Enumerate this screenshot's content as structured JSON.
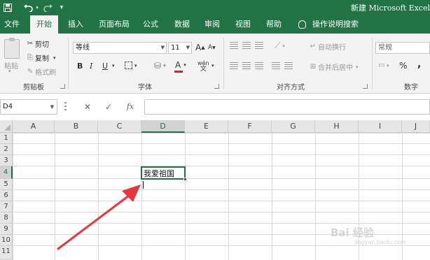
{
  "titlebar": {
    "document_title": "新建 Microsoft Excel",
    "save_icon": "save-icon",
    "undo_icon": "undo-icon",
    "redo_icon": "redo-icon",
    "customize_icon": "customize-quick-access-icon"
  },
  "tabs": [
    {
      "label": "文件"
    },
    {
      "label": "开始"
    },
    {
      "label": "插入"
    },
    {
      "label": "页面布局"
    },
    {
      "label": "公式"
    },
    {
      "label": "数据"
    },
    {
      "label": "审阅"
    },
    {
      "label": "视图"
    },
    {
      "label": "帮助"
    }
  ],
  "tellme": {
    "label": "操作说明搜索",
    "icon": "lightbulb-icon"
  },
  "clipboard": {
    "paste": "粘贴",
    "cut": "剪切",
    "copy": "复制",
    "format_painter": "格式刷",
    "group": "剪贴板"
  },
  "font": {
    "name": "等线",
    "size": "11",
    "grow": "A",
    "shrink": "A",
    "bold": "B",
    "italic": "I",
    "underline": "U",
    "font_color": "A",
    "phonetic": "wén",
    "group": "字体"
  },
  "alignment": {
    "wrap_text": "自动换行",
    "merge_center": "合并后居中",
    "group": "对齐方式"
  },
  "number": {
    "format": "常规",
    "percent": "%",
    "comma": ",",
    "group": "数字"
  },
  "formula_bar": {
    "name_box": "D4",
    "cancel": "✕",
    "enter": "✓",
    "fx": "fx",
    "value": ""
  },
  "sheet": {
    "columns": [
      "A",
      "B",
      "C",
      "D",
      "E",
      "F",
      "G",
      "H",
      "I",
      "J"
    ],
    "rows": [
      "1",
      "2",
      "3",
      "4",
      "5",
      "6",
      "7",
      "8",
      "9",
      "10",
      "11"
    ],
    "active_cell": "D4",
    "cell_d4": "我爱祖国"
  },
  "watermark": {
    "text": "Bai 经验",
    "sub": "jingyan.baidu.com"
  },
  "colors": {
    "accent": "#217346",
    "arrow": "#e8373a",
    "font_color_bar": "#e02020"
  }
}
